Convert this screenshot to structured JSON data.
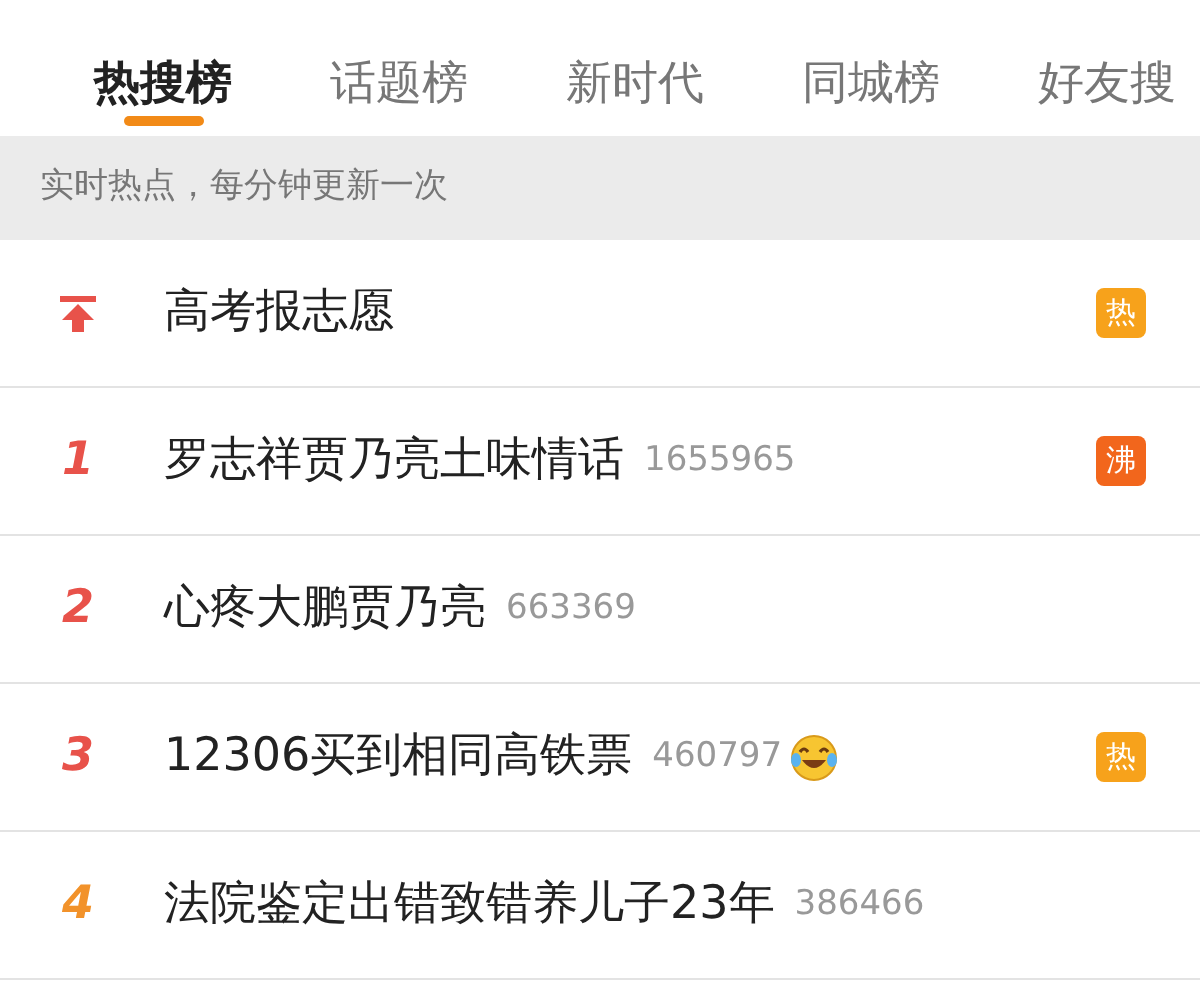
{
  "tabs": [
    {
      "label": "热搜榜",
      "selected": true
    },
    {
      "label": "话题榜",
      "selected": false
    },
    {
      "label": "新时代",
      "selected": false
    },
    {
      "label": "同城榜",
      "selected": false
    },
    {
      "label": "好友搜",
      "selected": false
    }
  ],
  "notice": "实时热点，每分钟更新一次",
  "rows": [
    {
      "kind": "pinned",
      "title": "高考报志愿",
      "badge": {
        "text": "热",
        "color": "#f7a21b"
      }
    },
    {
      "kind": "ranked",
      "rank": "1",
      "color": "#e8524a",
      "title": "罗志祥贾乃亮土味情话",
      "count": "1655965",
      "badge": {
        "text": "沸",
        "color": "#f2661c"
      }
    },
    {
      "kind": "ranked",
      "rank": "2",
      "color": "#e8524a",
      "title": "心疼大鹏贾乃亮",
      "count": "663369"
    },
    {
      "kind": "ranked",
      "rank": "3",
      "color": "#e8524a",
      "title": "12306买到相同高铁票",
      "count": "460797",
      "emoji": true,
      "badge": {
        "text": "热",
        "color": "#f7a21b"
      }
    },
    {
      "kind": "ranked",
      "rank": "4",
      "color": "#f2922a",
      "title": "法院鉴定出错致错养儿子23年",
      "count": "386466"
    }
  ]
}
